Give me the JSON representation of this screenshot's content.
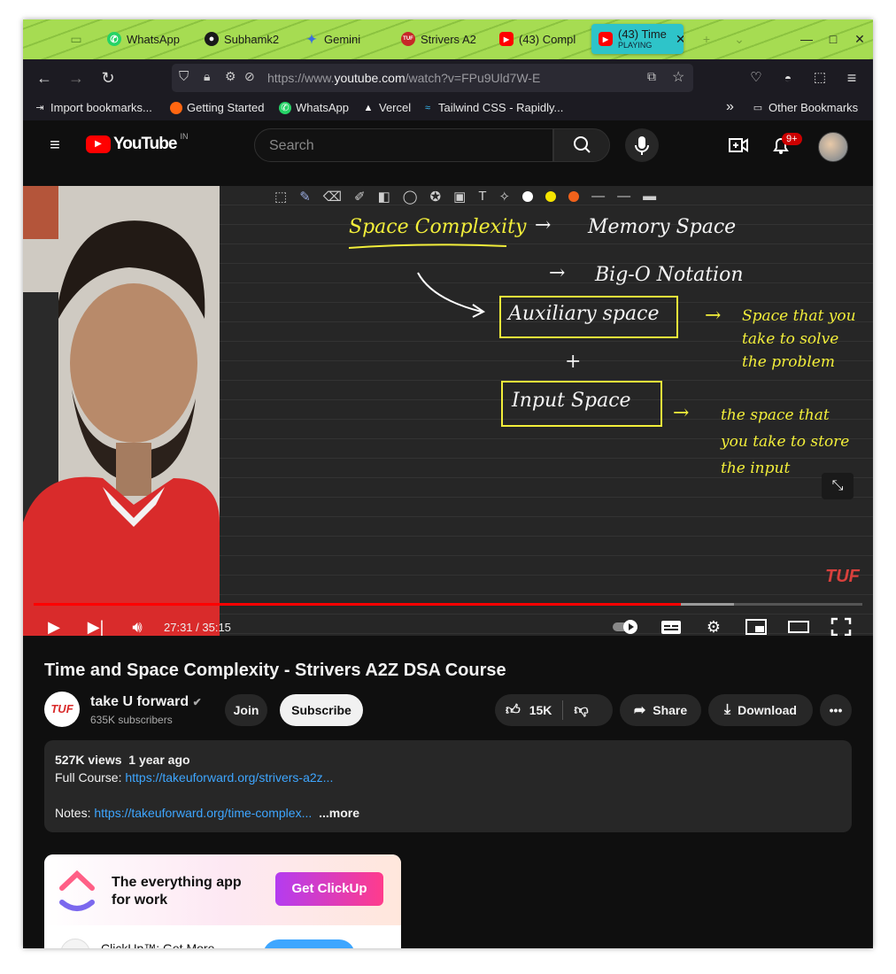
{
  "browser": {
    "tabs": [
      {
        "label": "WhatsApp",
        "icon": "whatsapp-icon"
      },
      {
        "label": "Subhamk2",
        "icon": "github-icon"
      },
      {
        "label": "Gemini",
        "icon": "gemini-icon"
      },
      {
        "label": "Strivers A2",
        "icon": "tuf-icon"
      },
      {
        "label": "(43) Compl",
        "icon": "youtube-icon"
      },
      {
        "label": "(43) Time",
        "sublabel": "PLAYING",
        "icon": "youtube-icon"
      }
    ],
    "url_prefix": "https://www.",
    "url_domain": "youtube.com",
    "url_path": "/watch?v=FPu9Uld7W-E",
    "bookmarks": [
      {
        "label": "Import bookmarks...",
        "icon": "import-icon"
      },
      {
        "label": "Getting Started",
        "icon": "firefox-icon"
      },
      {
        "label": "WhatsApp",
        "icon": "whatsapp-icon"
      },
      {
        "label": "Vercel",
        "icon": "vercel-icon"
      },
      {
        "label": "Tailwind CSS - Rapidly...",
        "icon": "tailwind-icon"
      }
    ],
    "other_bookmarks": "Other Bookmarks"
  },
  "youtube": {
    "logo_text": "YouTube",
    "country": "IN",
    "search_placeholder": "Search",
    "notification_count": "9+"
  },
  "player": {
    "time": "27:31 / 35:15",
    "progress": 0.781,
    "buffered": 0.845,
    "watermark": "TUF",
    "board_text": {
      "heading": "Space Complexity",
      "memory": "Memory Space",
      "bigo": "Big-O Notation",
      "auxiliary": "Auxiliary space",
      "plus": "+",
      "input": "Input Space",
      "aux_note": "Space that you take to solve the problem",
      "input_note": "the space that you take to store the input"
    }
  },
  "video": {
    "title": "Time and Space Complexity - Strivers A2Z DSA Course",
    "channel": "take U forward",
    "subscribers": "635K subscribers",
    "join": "Join",
    "subscribe": "Subscribe",
    "likes": "15K",
    "share": "Share",
    "download": "Download"
  },
  "description": {
    "views": "527K views",
    "date": "1 year ago",
    "course_label": "Full Course:",
    "course_link": "https://takeuforward.org/strivers-a2z...",
    "notes_label": "Notes:",
    "notes_link": "https://takeuforward.org/time-complex...",
    "more": "...more"
  },
  "ad": {
    "headline": "The everything app for work",
    "cta": "Get ClickUp",
    "brand": "ClickUp™: Get More"
  },
  "colors": {
    "tab_bar": "#a6dc52",
    "active_tab": "#2ec4c9",
    "youtube_red": "#ff0000",
    "link": "#3ea6ff",
    "ink_yellow": "#f2ee3a"
  }
}
